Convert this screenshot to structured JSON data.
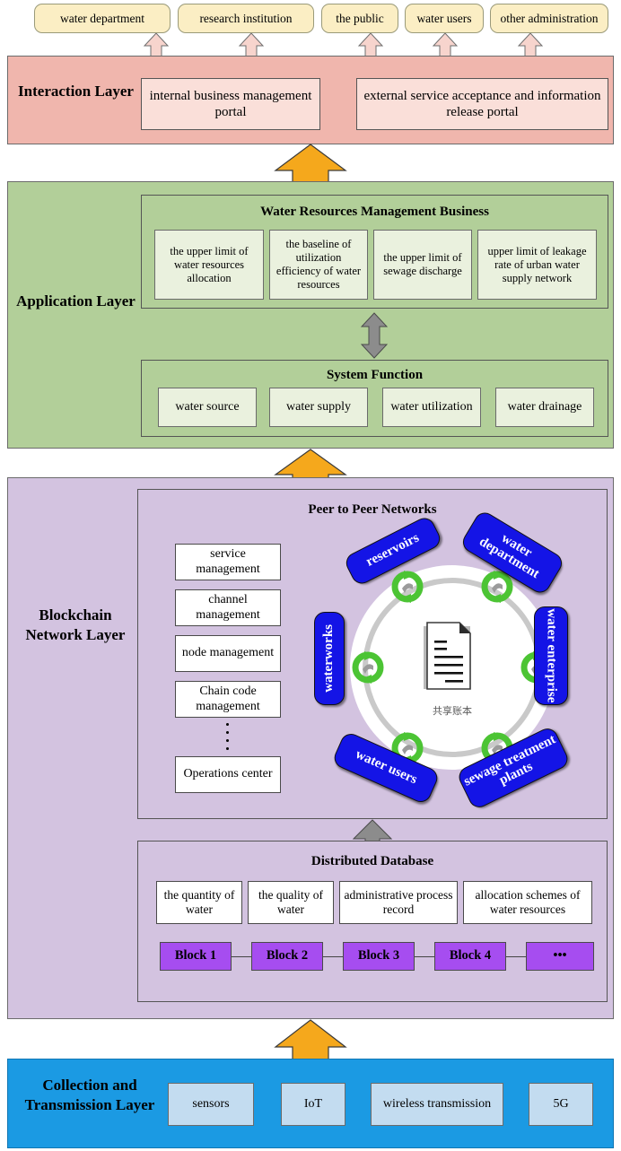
{
  "stakeholders": [
    {
      "label": "water department"
    },
    {
      "label": "research institution"
    },
    {
      "label": "the public"
    },
    {
      "label": "water users"
    },
    {
      "label": "other administration"
    }
  ],
  "layers": {
    "interaction": {
      "label": "Interaction Layer",
      "color": "#f0b6ad",
      "portals": [
        {
          "label": "internal business management portal"
        },
        {
          "label": "external service acceptance and information release portal"
        }
      ]
    },
    "application": {
      "label": "Application Layer",
      "color": "#b2cf99",
      "business": {
        "title": "Water Resources Management Business",
        "items": [
          {
            "label": "the upper limit of water resources allocation"
          },
          {
            "label": "the baseline of utilization efficiency of water resources"
          },
          {
            "label": "the upper limit of sewage discharge"
          },
          {
            "label": "upper limit of leakage rate of urban water supply network"
          }
        ]
      },
      "system_function": {
        "title": "System Function",
        "items": [
          {
            "label": "water source"
          },
          {
            "label": "water supply"
          },
          {
            "label": "water utilization"
          },
          {
            "label": "water drainage"
          }
        ]
      }
    },
    "blockchain": {
      "label": "Blockchain Network Layer",
      "color": "#d3c3e0",
      "p2p": {
        "title": "Peer to Peer Networks",
        "management_items": [
          {
            "label": "service management"
          },
          {
            "label": "channel management"
          },
          {
            "label": "node management"
          },
          {
            "label": "Chain code management"
          },
          {
            "label": "Operations center"
          }
        ],
        "ellipsis": "⋮",
        "nodes": [
          {
            "label": "reservoirs"
          },
          {
            "label": "water department"
          },
          {
            "label": "water enterprise"
          },
          {
            "label": "sewage treatment plants"
          },
          {
            "label": "water users"
          },
          {
            "label": "waterworks"
          }
        ],
        "ledger_caption": "共享账本",
        "node_color": "#1414e6",
        "sync_color": "#4cc434"
      },
      "database": {
        "title": "Distributed Database",
        "items": [
          {
            "label": "the quantity of water"
          },
          {
            "label": "the quality of water"
          },
          {
            "label": "administrative process record"
          },
          {
            "label": "allocation schemes of water resources"
          }
        ],
        "blocks": [
          {
            "label": "Block 1"
          },
          {
            "label": "Block 2"
          },
          {
            "label": "Block 3"
          },
          {
            "label": "Block 4"
          },
          {
            "label": "•••"
          }
        ],
        "block_color": "#a64df0"
      }
    },
    "collection": {
      "label": "Collection and Transmission Layer",
      "color": "#1b9ae3",
      "items": [
        {
          "label": "sensors"
        },
        {
          "label": "IoT"
        },
        {
          "label": "wireless transmission"
        },
        {
          "label": "5G"
        }
      ]
    }
  },
  "connectors": {
    "arrow_orange_color": "#f5a81c",
    "arrow_pink_color": "#f7d4cd",
    "arrow_gray_color": "#8c8c8c"
  }
}
